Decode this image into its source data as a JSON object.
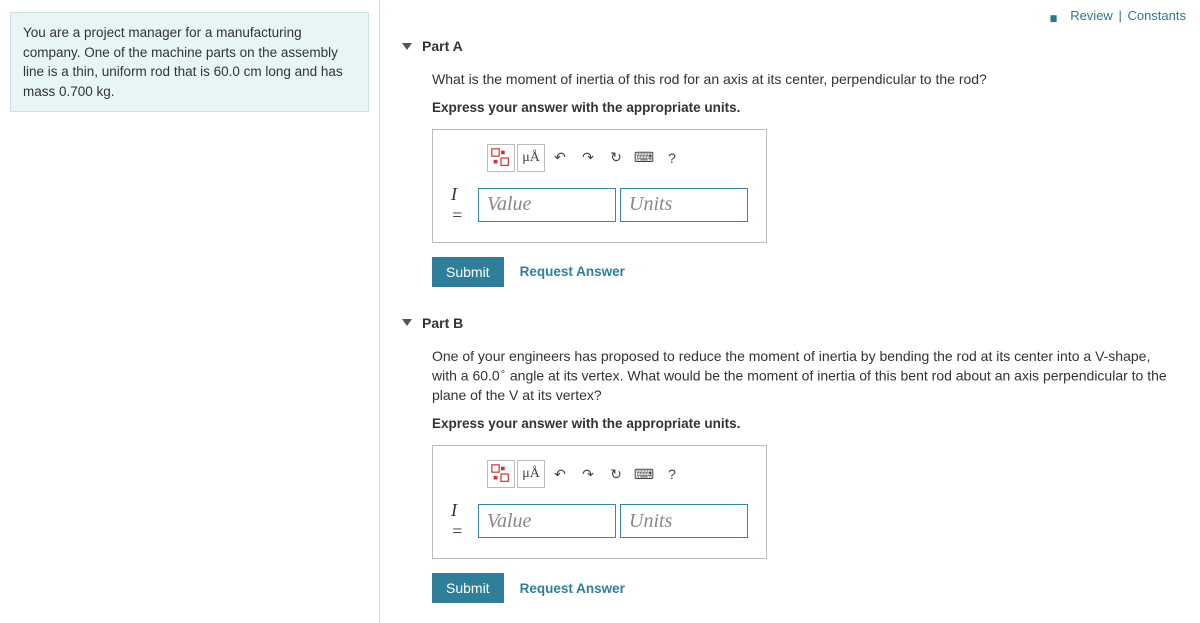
{
  "topLinks": {
    "review": "Review",
    "constants": "Constants"
  },
  "problem": {
    "text": "You are a project manager for a manufacturing company. One of the machine parts on the assembly line is a thin, uniform rod that is 60.0 cm long and has mass 0.700 kg."
  },
  "toolbar": {
    "units_button": "μÅ",
    "undo": "↶",
    "redo": "↷",
    "reset": "↻",
    "keyboard": "⌨",
    "help": "?"
  },
  "common": {
    "express": "Express your answer with the appropriate units.",
    "ieq": "I =",
    "value_ph": "Value",
    "units_ph": "Units",
    "submit": "Submit",
    "request": "Request Answer"
  },
  "partA": {
    "title": "Part A",
    "question": "What is the moment of inertia of this rod for an axis at its center, perpendicular to the rod?"
  },
  "partB": {
    "title": "Part B",
    "question_pre": "One of your engineers has proposed to reduce the moment of inertia by bending the rod at its center into a V-shape, with a 60.0",
    "deg": "∘",
    "question_post": " angle at its vertex. What would be the moment of inertia of this bent rod about an axis perpendicular to the plane of the V at its vertex?"
  }
}
